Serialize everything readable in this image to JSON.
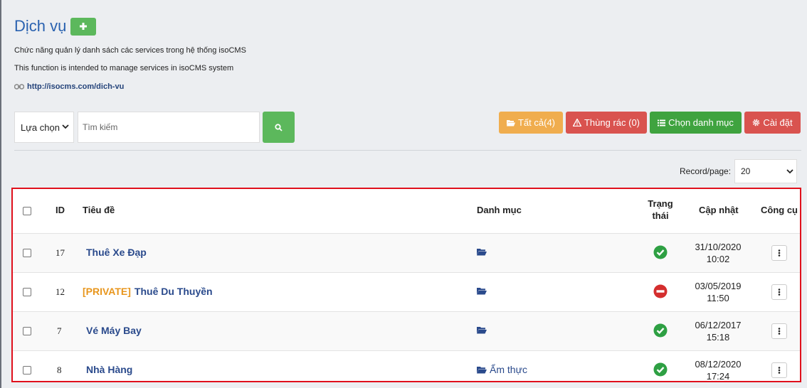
{
  "header": {
    "title": "Dịch vụ",
    "desc_vi": "Chức năng quản lý danh sách các services trong hệ thống isoCMS",
    "desc_en": "This function is intended to manage services in isoCMS system",
    "link": "http://isocms.com/dich-vu"
  },
  "filters": {
    "select_value": "Lựa chọn",
    "search_placeholder": "Tìm kiếm"
  },
  "toolbar": {
    "all_label": "Tất cả(4)",
    "trash_label": "Thùng rác (0)",
    "category_label": "Chọn danh mục",
    "settings_label": "Cài đặt"
  },
  "colors": {
    "all": "#f0ad4e",
    "trash": "#d9534f",
    "category": "#3fa33f",
    "settings": "#d9534f",
    "active": "#2ea043",
    "inactive": "#d42e2e"
  },
  "pagination": {
    "label": "Record/page:",
    "value": "20"
  },
  "table": {
    "headers": {
      "id": "ID",
      "title": "Tiêu đề",
      "category": "Danh mục",
      "status_line1": "Trạng",
      "status_line2": "thái",
      "updated": "Cập nhật",
      "tools": "Công cụ"
    },
    "rows": [
      {
        "id": "17",
        "private": "",
        "title": "Thuê Xe Đạp",
        "category": "",
        "status": "active",
        "date": "31/10/2020",
        "time": "10:02"
      },
      {
        "id": "12",
        "private": "[PRIVATE]",
        "title": "Thuê Du Thuyền",
        "category": "",
        "status": "inactive",
        "date": "03/05/2019",
        "time": "11:50"
      },
      {
        "id": "7",
        "private": "",
        "title": "Vé Máy Bay",
        "category": "",
        "status": "active",
        "date": "06/12/2017",
        "time": "15:18"
      },
      {
        "id": "8",
        "private": "",
        "title": "Nhà Hàng",
        "category": "Ẩm thực",
        "status": "active",
        "date": "08/12/2020",
        "time": "17:24"
      }
    ]
  }
}
